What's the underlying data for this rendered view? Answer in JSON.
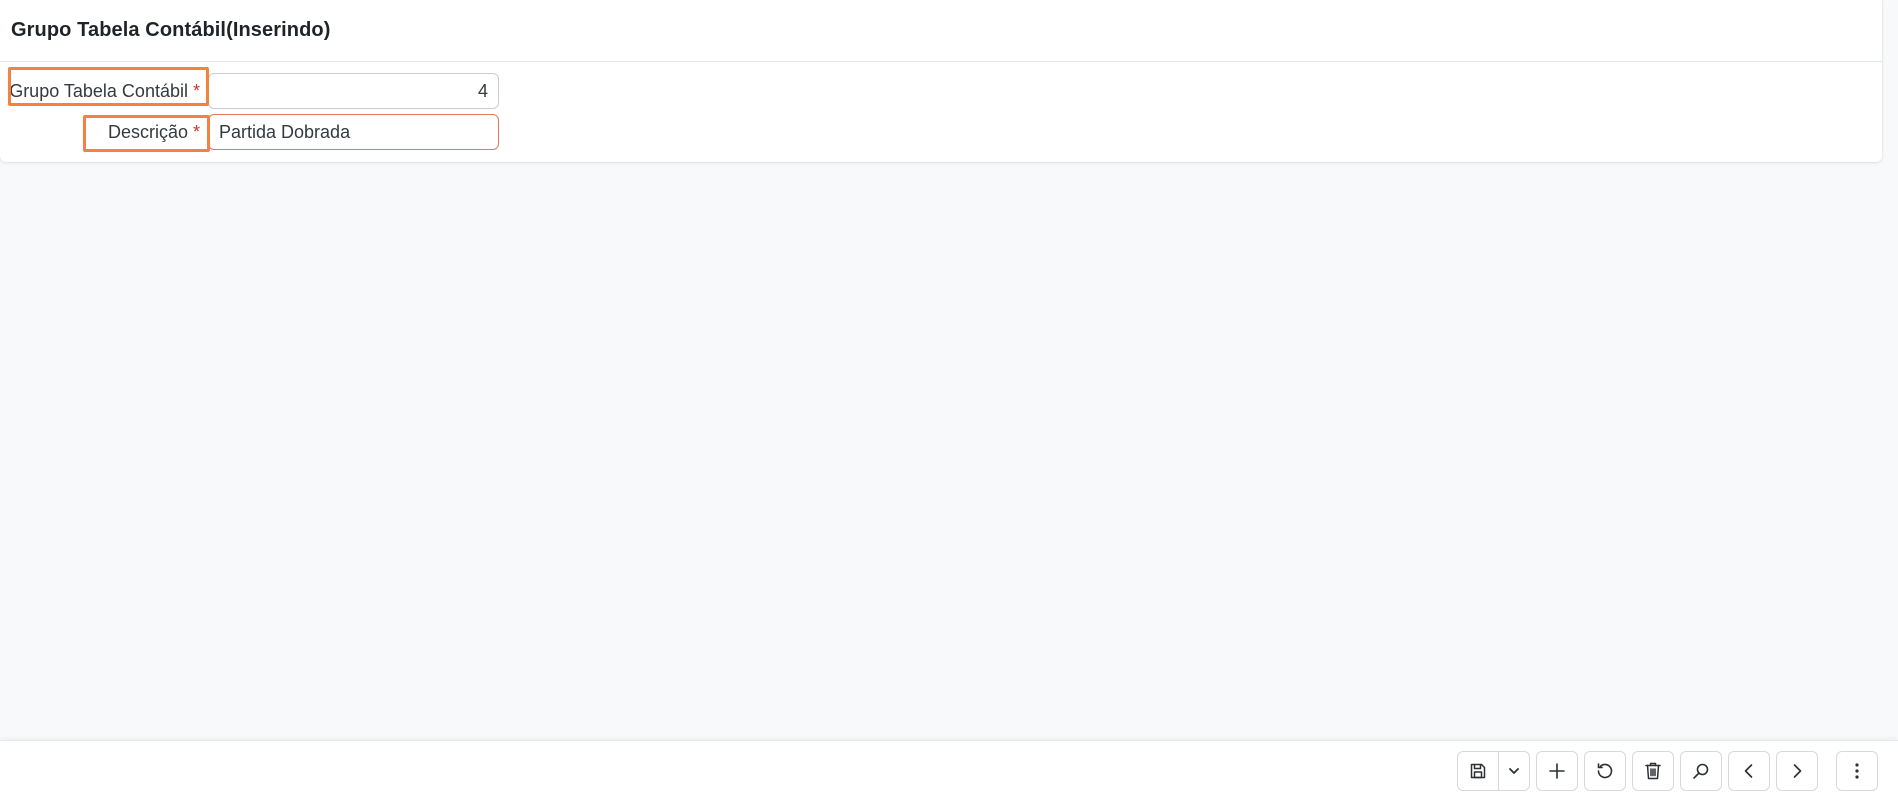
{
  "header": {
    "title": "Grupo Tabela Contábil(Inserindo)"
  },
  "form": {
    "fields": [
      {
        "label": "Grupo Tabela Contábil",
        "required_mark": "*",
        "value": "4"
      },
      {
        "label": "Descrição",
        "required_mark": "*",
        "value": "Partida Dobrada"
      }
    ]
  },
  "toolbar": {
    "buttons": [
      {
        "icon": "save-icon"
      },
      {
        "icon": "chevron-down-icon"
      },
      {
        "icon": "plus-icon"
      },
      {
        "icon": "refresh-icon"
      },
      {
        "icon": "trash-icon"
      },
      {
        "icon": "search-icon"
      },
      {
        "icon": "chevron-left-icon"
      },
      {
        "icon": "chevron-right-icon"
      },
      {
        "icon": "more-vertical-icon"
      }
    ]
  },
  "colors": {
    "highlight": "#f5813f",
    "required": "#d9342b",
    "input_border": "#e07a5f"
  }
}
